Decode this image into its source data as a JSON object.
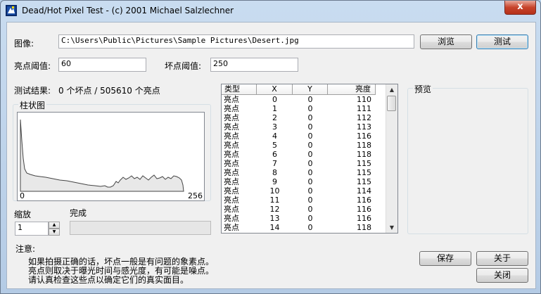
{
  "window": {
    "title": "Dead/Hot Pixel Test - (c) 2001 Michael Salzlechner",
    "close_glyph": "x"
  },
  "image": {
    "label": "图像:",
    "path": "C:\\Users\\Public\\Pictures\\Sample Pictures\\Desert.jpg",
    "browse_label": "浏览",
    "test_label": "测试"
  },
  "thresholds": {
    "hot_label": "亮点阈值:",
    "hot_value": "60",
    "dead_label": "坏点阈值:",
    "dead_value": "250"
  },
  "result": {
    "label": "测试结果:",
    "text": "0 个坏点 / 505610 个亮点"
  },
  "histogram": {
    "title": "柱状图",
    "min_label": "0",
    "max_label": "256"
  },
  "zoom": {
    "label": "缩放",
    "value": "1"
  },
  "progress": {
    "label": "完成",
    "value": 0
  },
  "list": {
    "columns": [
      "类型",
      "X",
      "Y",
      "亮度"
    ],
    "rows": [
      [
        "亮点",
        "0",
        "0",
        "110"
      ],
      [
        "亮点",
        "1",
        "0",
        "111"
      ],
      [
        "亮点",
        "2",
        "0",
        "112"
      ],
      [
        "亮点",
        "3",
        "0",
        "113"
      ],
      [
        "亮点",
        "4",
        "0",
        "116"
      ],
      [
        "亮点",
        "5",
        "0",
        "118"
      ],
      [
        "亮点",
        "6",
        "0",
        "118"
      ],
      [
        "亮点",
        "7",
        "0",
        "115"
      ],
      [
        "亮点",
        "8",
        "0",
        "115"
      ],
      [
        "亮点",
        "9",
        "0",
        "115"
      ],
      [
        "亮点",
        "10",
        "0",
        "114"
      ],
      [
        "亮点",
        "11",
        "0",
        "116"
      ],
      [
        "亮点",
        "12",
        "0",
        "116"
      ],
      [
        "亮点",
        "13",
        "0",
        "116"
      ],
      [
        "亮点",
        "14",
        "0",
        "118"
      ]
    ]
  },
  "preview": {
    "title": "预览"
  },
  "notes": {
    "title": "注意:",
    "lines": [
      "如果拍摄正确的话，坏点一般是有问题的象素点。",
      "亮点则取决于曝光时间与感光度，有可能是噪点。",
      "请认真检查这些点以确定它们的真实面目。"
    ]
  },
  "buttons": {
    "save": "保存",
    "about": "关于",
    "close": "关闭"
  },
  "colors": {
    "histogram_fill": "#e8e8e8",
    "histogram_line": "#444444",
    "close_button": "#c7432b"
  }
}
